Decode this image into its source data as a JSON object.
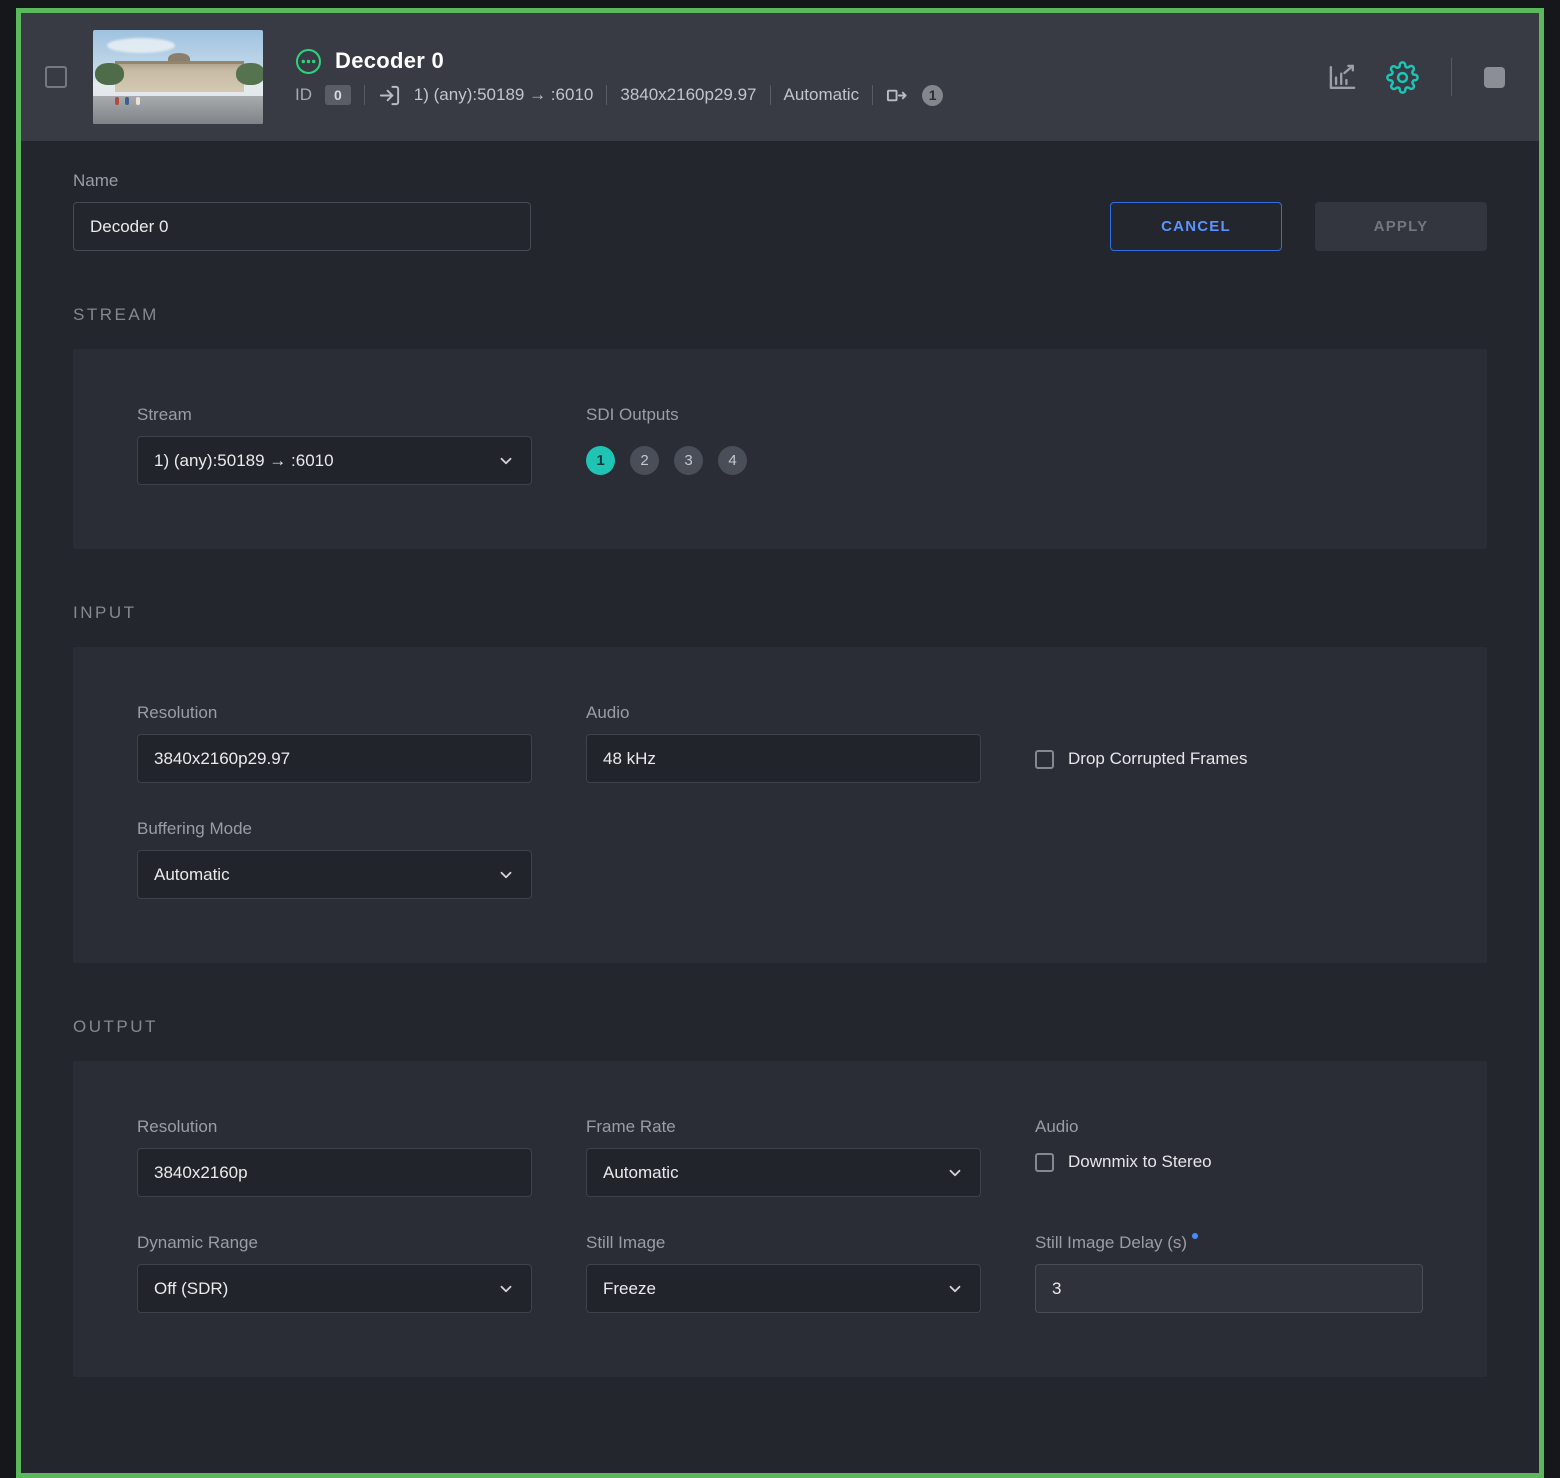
{
  "header": {
    "title": "Decoder 0",
    "id_label": "ID",
    "id_value": "0",
    "stream_info": "1) (any):50189 → :6010",
    "resolution": "3840x2160p29.97",
    "mode": "Automatic",
    "output_count": "1"
  },
  "form": {
    "name_label": "Name",
    "name_value": "Decoder 0",
    "cancel_label": "CANCEL",
    "apply_label": "APPLY"
  },
  "stream_section": {
    "title": "STREAM",
    "stream_label": "Stream",
    "stream_value": "1) (any):50189 → :6010",
    "sdi_label": "SDI Outputs",
    "sdi_outputs": [
      "1",
      "2",
      "3",
      "4"
    ],
    "sdi_active_index": 0
  },
  "input_section": {
    "title": "INPUT",
    "resolution_label": "Resolution",
    "resolution_value": "3840x2160p29.97",
    "audio_label": "Audio",
    "audio_value": "48 kHz",
    "drop_frames_label": "Drop Corrupted Frames",
    "drop_frames_checked": false,
    "buffering_label": "Buffering Mode",
    "buffering_value": "Automatic"
  },
  "output_section": {
    "title": "OUTPUT",
    "resolution_label": "Resolution",
    "resolution_value": "3840x2160p",
    "framerate_label": "Frame Rate",
    "framerate_value": "Automatic",
    "audio_label": "Audio",
    "downmix_label": "Downmix to Stereo",
    "downmix_checked": false,
    "dynamic_range_label": "Dynamic Range",
    "dynamic_range_value": "Off (SDR)",
    "still_image_label": "Still Image",
    "still_image_value": "Freeze",
    "still_delay_label": "Still Image Delay (s)",
    "still_delay_value": "3"
  },
  "colors": {
    "selection_green": "#5cb85c",
    "accent_teal": "#1fc4b4",
    "accent_blue": "#4a8cff",
    "status_green": "#2fd37a"
  }
}
